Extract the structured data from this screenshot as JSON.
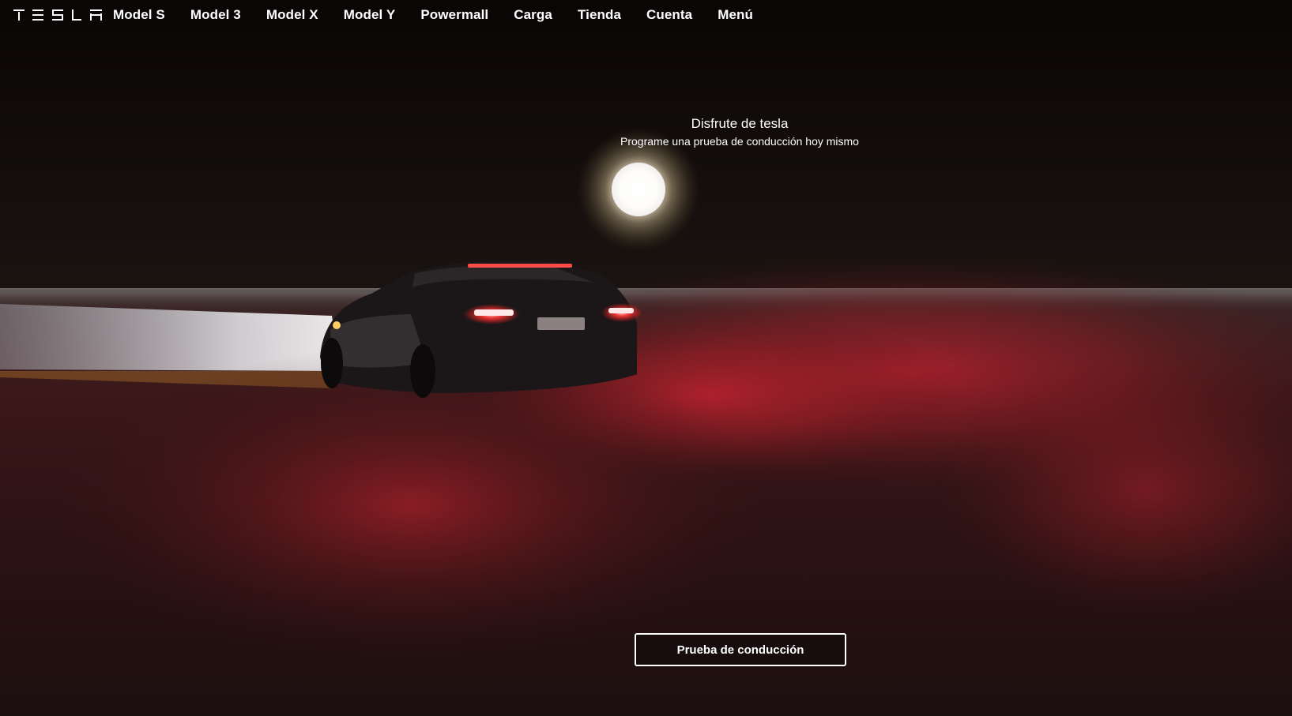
{
  "brand": {
    "logo_text": "TESLA"
  },
  "nav": {
    "items": [
      {
        "label": "Model S"
      },
      {
        "label": "Model 3"
      },
      {
        "label": "Model X"
      },
      {
        "label": "Model Y"
      },
      {
        "label": "Powermall"
      },
      {
        "label": "Carga"
      },
      {
        "label": "Tienda"
      },
      {
        "label": "Cuenta"
      },
      {
        "label": "Menú"
      }
    ]
  },
  "hero": {
    "title": "Disfrute de tesla",
    "subtitle": "Programe una prueba de conducción hoy mismo",
    "cta_label": "Prueba de conducción"
  },
  "colors": {
    "background": "#0b0807",
    "text": "#ffffff",
    "taillight_red": "#ff2a2a",
    "smoke_red": "#b01e28"
  }
}
